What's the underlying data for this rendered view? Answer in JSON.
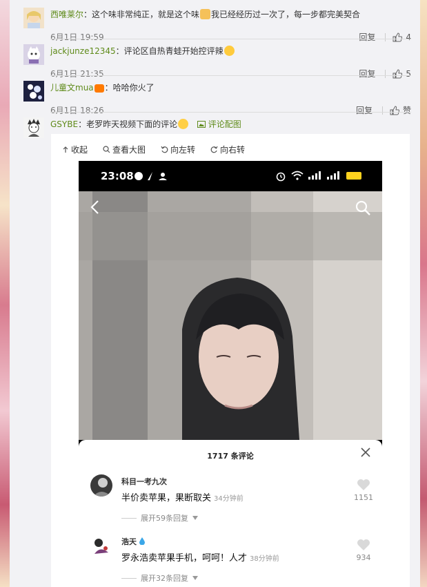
{
  "comments": [
    {
      "username": "西唯莱尔",
      "text_before": "：这个味非常纯正，就是这个味",
      "text_after": "我已经经历过一次了，每一步都完美契合",
      "time": "6月1日 19:59",
      "reply_label": "回复",
      "likes": "4"
    },
    {
      "username": "jackjunze12345",
      "text_before": "：评论区自热青蛙开始控评辣",
      "text_after": "",
      "time": "6月1日 21:35",
      "reply_label": "回复",
      "likes": "5"
    },
    {
      "username": "儿童文mua",
      "text_before": "：哈哈你火了",
      "text_after": "",
      "time": "6月1日 18:26",
      "reply_label": "回复",
      "likes": "赞"
    },
    {
      "username": "GSYBE",
      "text_before": "：老罗昨天视频下面的评论",
      "text_after": "",
      "image_link": "评论配图"
    }
  ],
  "toolbar": {
    "collapse": "收起",
    "view_large": "查看大图",
    "rotate_left": "向左转",
    "rotate_right": "向右转"
  },
  "phone": {
    "time": "23:08",
    "sheet_title": "1717 条评论",
    "comments": [
      {
        "name": "科目一考九次",
        "text": "半价卖苹果，果断取关",
        "time": "34分钟前",
        "likes": "1151",
        "expand": "展开59条回复"
      },
      {
        "name": "浩天",
        "text": "罗永浩卖苹果手机，呵呵！人才",
        "time": "38分钟前",
        "likes": "934",
        "expand": "展开32条回复"
      }
    ]
  },
  "colors": {
    "username": "#5e8a19",
    "panel": "#f2f2f5",
    "battery": "#ffd21e"
  }
}
